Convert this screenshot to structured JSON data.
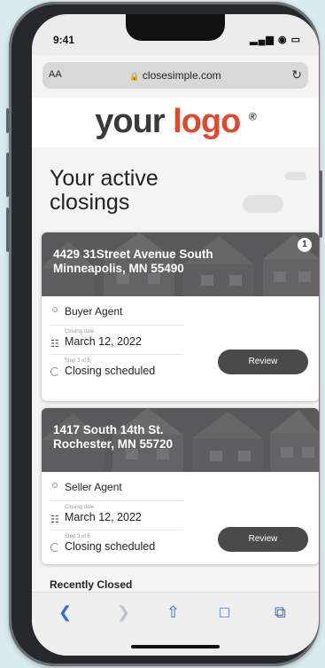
{
  "status_bar": {
    "time": "9:41",
    "signal": "▂▄▆ ◉ ▭"
  },
  "browser": {
    "aa": "AA",
    "url": "closesimple.com",
    "reload": "↻"
  },
  "logo": {
    "part1": "your",
    "part2": "logo",
    "mark": "®"
  },
  "page": {
    "heading": "Your active closings",
    "recently_closed": "Recently Closed"
  },
  "cards": [
    {
      "address_line1": "4429 31Street Avenue South",
      "address_line2": "Minneapolis, MN 55490",
      "badge": "1",
      "role": "Buyer Agent",
      "date_label": "Closing date",
      "date": "March 12, 2022",
      "step_label": "Step 3 of 5",
      "step": "Closing scheduled",
      "button": "Review"
    },
    {
      "address_line1": "1417 South 14th St.",
      "address_line2": "Rochester, MN 55720",
      "role": "Seller Agent",
      "date_label": "Closing date",
      "date": "March 12, 2022",
      "step_label": "Step 3 of 5",
      "step": "Closing scheduled",
      "button": "Review"
    }
  ],
  "toolbar": {
    "back_icon": "chevron-left-icon",
    "forward_icon": "chevron-right-icon",
    "share_icon": "share-icon",
    "bookmarks_icon": "book-icon",
    "tabs_icon": "tabs-icon"
  },
  "colors": {
    "accent": "#e0492b",
    "button": "#4a4a4a",
    "link": "#2f6fd6"
  }
}
